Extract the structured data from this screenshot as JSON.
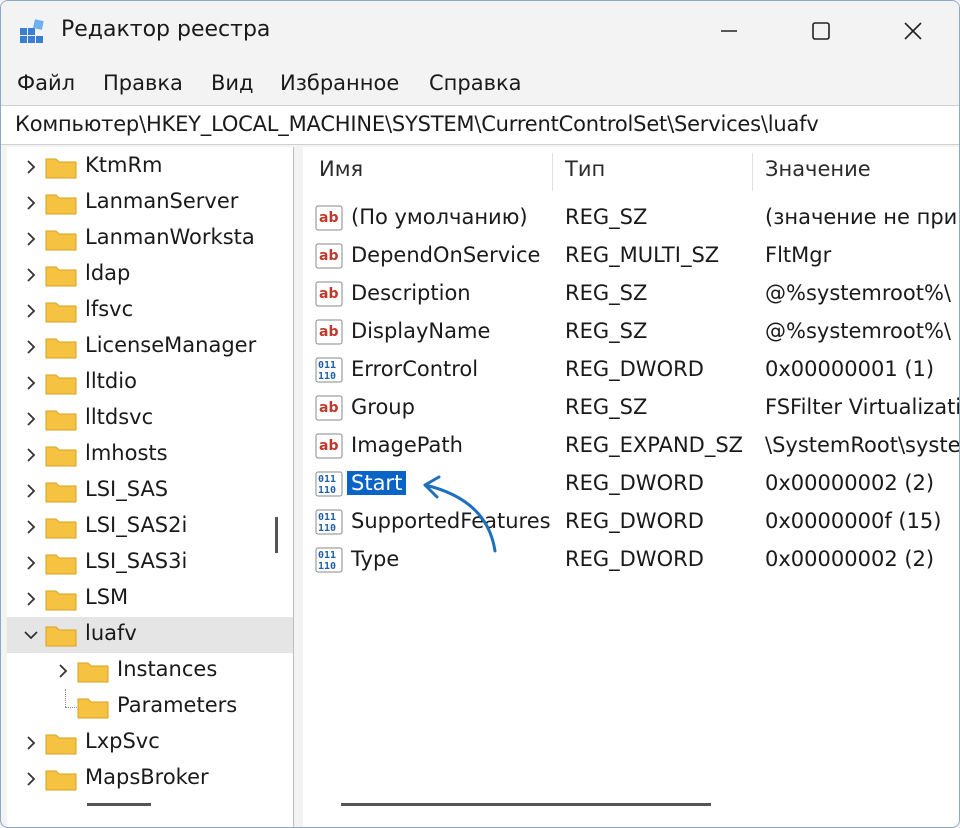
{
  "window": {
    "title": "Редактор реестра",
    "app_icon": "registry-editor-icon",
    "controls": [
      "minimize-icon",
      "maximize-icon",
      "close-icon"
    ]
  },
  "menu": [
    "Файл",
    "Правка",
    "Вид",
    "Избранное",
    "Справка"
  ],
  "address": "Компьютер\\HKEY_LOCAL_MACHINE\\SYSTEM\\CurrentControlSet\\Services\\luafv",
  "tree": [
    {
      "label": "KtmRm",
      "level": 0,
      "expanded": false
    },
    {
      "label": "LanmanServer",
      "level": 0,
      "expanded": false
    },
    {
      "label": "LanmanWorksta",
      "level": 0,
      "expanded": false
    },
    {
      "label": "ldap",
      "level": 0,
      "expanded": false
    },
    {
      "label": "lfsvc",
      "level": 0,
      "expanded": false
    },
    {
      "label": "LicenseManager",
      "level": 0,
      "expanded": false
    },
    {
      "label": "lltdio",
      "level": 0,
      "expanded": false
    },
    {
      "label": "lltdsvc",
      "level": 0,
      "expanded": false
    },
    {
      "label": "lmhosts",
      "level": 0,
      "expanded": false
    },
    {
      "label": "LSI_SAS",
      "level": 0,
      "expanded": false
    },
    {
      "label": "LSI_SAS2i",
      "level": 0,
      "expanded": false
    },
    {
      "label": "LSI_SAS3i",
      "level": 0,
      "expanded": false
    },
    {
      "label": "LSM",
      "level": 0,
      "expanded": false
    },
    {
      "label": "luafv",
      "level": 0,
      "expanded": true,
      "selected": true
    },
    {
      "label": "Instances",
      "level": 1,
      "expanded": false
    },
    {
      "label": "Parameters",
      "level": 1,
      "leaf": true
    },
    {
      "label": "LxpSvc",
      "level": 0,
      "expanded": false
    },
    {
      "label": "MapsBroker",
      "level": 0,
      "expanded": false
    }
  ],
  "columns": [
    "Имя",
    "Тип",
    "Значение"
  ],
  "values": [
    {
      "icon": "string-value-icon",
      "name": "(По умолчанию)",
      "type": "REG_SZ",
      "data": "(значение не при"
    },
    {
      "icon": "string-value-icon",
      "name": "DependOnService",
      "type": "REG_MULTI_SZ",
      "data": "FltMgr"
    },
    {
      "icon": "string-value-icon",
      "name": "Description",
      "type": "REG_SZ",
      "data": "@%systemroot%\\"
    },
    {
      "icon": "string-value-icon",
      "name": "DisplayName",
      "type": "REG_SZ",
      "data": "@%systemroot%\\"
    },
    {
      "icon": "binary-value-icon",
      "name": "ErrorControl",
      "type": "REG_DWORD",
      "data": "0x00000001 (1)"
    },
    {
      "icon": "string-value-icon",
      "name": "Group",
      "type": "REG_SZ",
      "data": "FSFilter Virtualizati"
    },
    {
      "icon": "string-value-icon",
      "name": "ImagePath",
      "type": "REG_EXPAND_SZ",
      "data": "\\SystemRoot\\syste"
    },
    {
      "icon": "binary-value-icon",
      "name": "Start",
      "type": "REG_DWORD",
      "data": "0x00000002 (2)",
      "selected": true
    },
    {
      "icon": "binary-value-icon",
      "name": "SupportedFeatures",
      "type": "REG_DWORD",
      "data": "0x0000000f (15)"
    },
    {
      "icon": "binary-value-icon",
      "name": "Type",
      "type": "REG_DWORD",
      "data": "0x00000002 (2)"
    }
  ],
  "colors": {
    "selection": "#0a64c8",
    "annotation_arrow": "#1f6fc0",
    "folder": "#f5c242"
  },
  "annotation": {
    "icon": "pointer-arrow-icon",
    "target": "Start"
  }
}
